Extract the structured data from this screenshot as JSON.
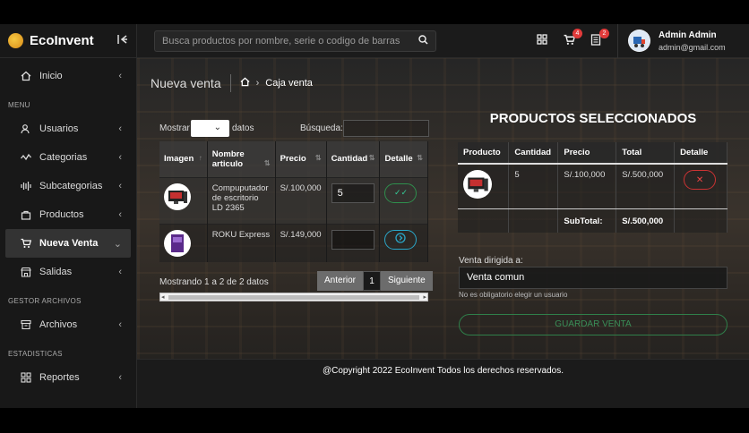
{
  "app": {
    "name": "EcoInvent"
  },
  "sidebar": {
    "items": [
      {
        "label": "Inicio"
      },
      {
        "label": "Usuarios"
      },
      {
        "label": "Categorias"
      },
      {
        "label": "Subcategorias"
      },
      {
        "label": "Productos"
      },
      {
        "label": "Nueva Venta"
      },
      {
        "label": "Salidas"
      },
      {
        "label": "Archivos"
      },
      {
        "label": "Reportes"
      }
    ],
    "groups": {
      "menu": "MENU",
      "gestor": "GESTOR ARCHIVOS",
      "estadisticas": "ESTADISTICAS"
    }
  },
  "topbar": {
    "search_placeholder": "Busca productos por nombre, serie o codigo de barras",
    "cart_badge": "4",
    "orders_badge": "2",
    "user_name": "Admin Admin",
    "user_email": "admin@gmail.com"
  },
  "page": {
    "title": "Nueva venta",
    "breadcrumb": "Caja venta"
  },
  "list": {
    "show_label": "Mostrar",
    "data_label": "datos",
    "search_label": "Búsqueda:",
    "headers": [
      "Imagen",
      "Nombre articulo",
      "Precio",
      "Cantidad",
      "Detalle"
    ],
    "rows": [
      {
        "name": "Compuputador de escritorio LD 2365",
        "price": "S/.100,000",
        "qty": "5"
      },
      {
        "name": "ROKU Express",
        "price": "S/.149,000",
        "qty": ""
      }
    ],
    "info": "Mostrando 1 a 2 de 2 datos",
    "prev": "Anterior",
    "page": "1",
    "next": "Siguiente"
  },
  "selected": {
    "title": "PRODUCTOS SELECCIONADOS",
    "headers": [
      "Producto",
      "Cantidad",
      "Precio",
      "Total",
      "Detalle"
    ],
    "rows": [
      {
        "qty": "5",
        "price": "S/.100,000",
        "total": "S/.500,000"
      }
    ],
    "subtotal_label": "SubTotal:",
    "subtotal": "S/.500,000"
  },
  "sale": {
    "label": "Venta dirigida a:",
    "value": "Venta comun",
    "hint": "No es obligatorio elegir un usuario",
    "save": "GUARDAR VENTA"
  },
  "footer": {
    "text": "@Copyright 2022 EcoInvent Todos los derechos reservados."
  }
}
